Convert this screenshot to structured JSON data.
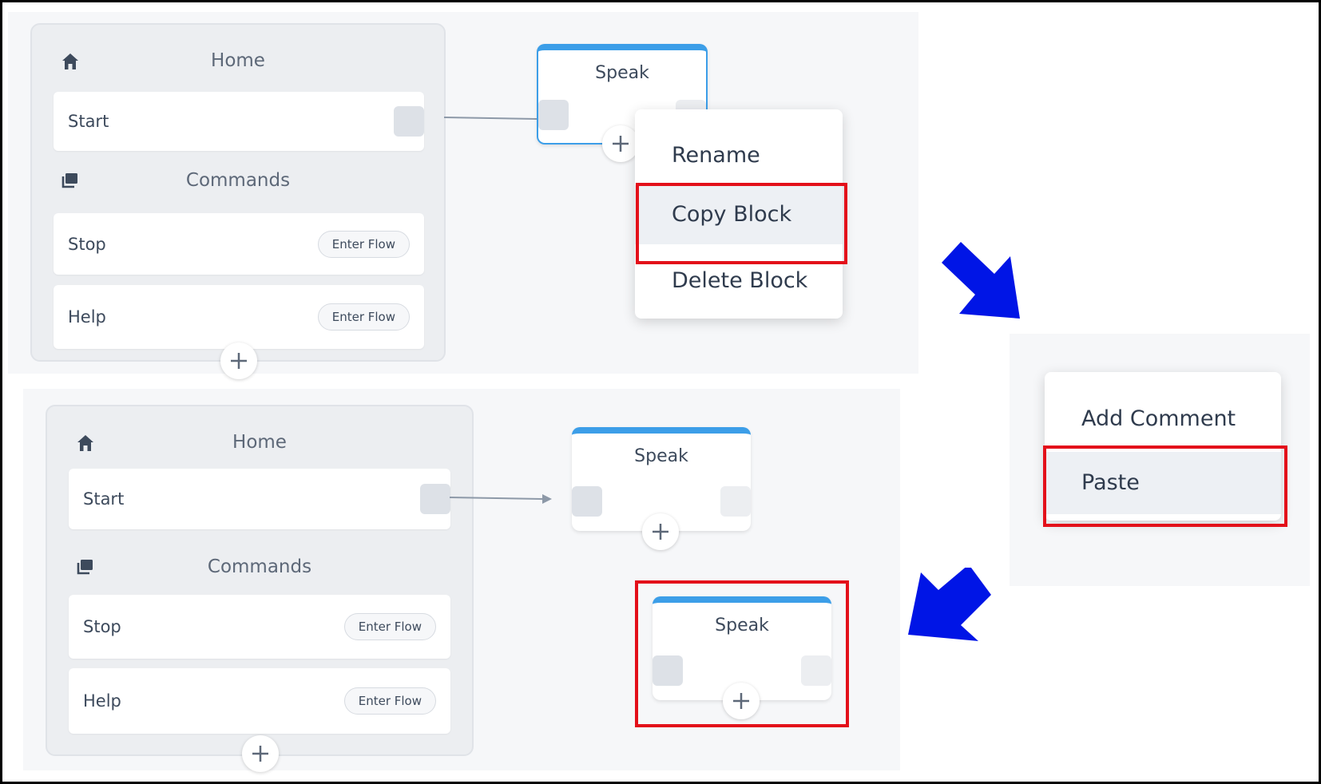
{
  "top_panel": {
    "home_title": "Home",
    "start_label": "Start",
    "commands_title": "Commands",
    "rows": [
      {
        "label": "Stop",
        "action": "Enter Flow"
      },
      {
        "label": "Help",
        "action": "Enter Flow"
      }
    ]
  },
  "top_speak": {
    "title": "Speak"
  },
  "block_menu": {
    "items": [
      "Rename",
      "Copy Block",
      "Delete Block"
    ],
    "highlighted": "Copy Block"
  },
  "canvas_menu": {
    "items": [
      "Add Comment",
      "Paste"
    ],
    "highlighted": "Paste"
  },
  "bottom_panel": {
    "home_title": "Home",
    "start_label": "Start",
    "commands_title": "Commands",
    "rows": [
      {
        "label": "Stop",
        "action": "Enter Flow"
      },
      {
        "label": "Help",
        "action": "Enter Flow"
      }
    ]
  },
  "bottom_speak": {
    "title": "Speak"
  },
  "pasted_speak": {
    "title": "Speak"
  },
  "colors": {
    "accent": "#3c9ee8",
    "highlight_border": "#e3101a",
    "flow_arrow": "#0015e6"
  },
  "icons": [
    "home-icon",
    "commands-icon",
    "plus-icon"
  ]
}
